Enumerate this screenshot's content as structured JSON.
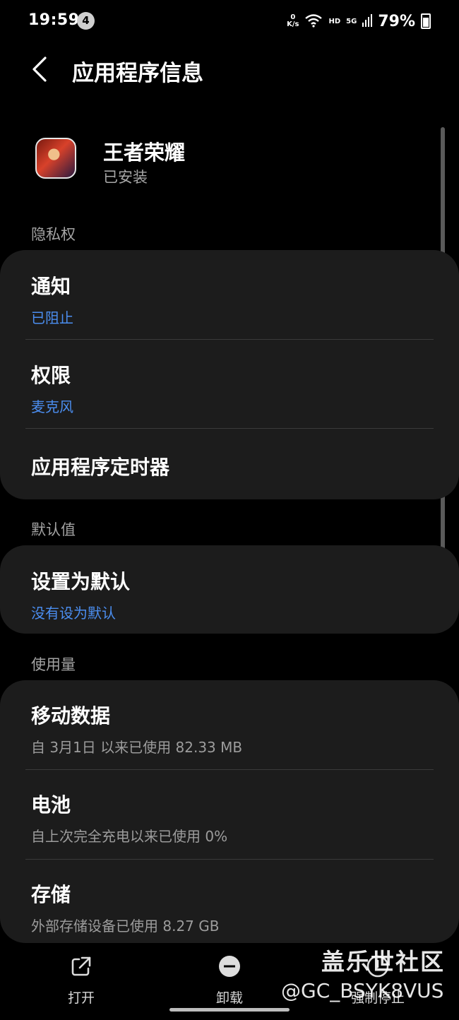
{
  "status_bar": {
    "time": "19:59",
    "notification_count": "4",
    "net_speed_value": "0",
    "net_speed_unit": "K/s",
    "hd_label": "HD",
    "network_label": "5G",
    "battery_percent": "79%"
  },
  "header": {
    "title": "应用程序信息",
    "back_icon": "chevron-left-icon"
  },
  "app": {
    "name": "王者荣耀",
    "status": "已安装"
  },
  "sections": {
    "privacy": "隐私权",
    "defaults": "默认值",
    "usage": "使用量"
  },
  "privacy_items": [
    {
      "title": "通知",
      "subtitle": "已阻止"
    },
    {
      "title": "权限",
      "subtitle": "麦克风"
    },
    {
      "title": "应用程序定时器"
    }
  ],
  "default_items": [
    {
      "title": "设置为默认",
      "subtitle": "没有设为默认"
    }
  ],
  "usage_items": [
    {
      "title": "移动数据",
      "subtitle": "自 3月1日 以来已使用 82.33 MB"
    },
    {
      "title": "电池",
      "subtitle": "自上次完全充电以来已使用 0%"
    },
    {
      "title": "存储",
      "subtitle": "外部存储设备已使用 8.27 GB"
    }
  ],
  "bottom_actions": {
    "open": "打开",
    "uninstall": "卸载",
    "force_stop": "强制停止"
  },
  "watermark": {
    "brand": "盖乐世社区",
    "user": "@GC_BSYK8VUS"
  },
  "colors": {
    "background": "#000000",
    "card": "#1c1c1c",
    "accent_blue": "#4b8ef0",
    "secondary_text": "#9c9c9c"
  }
}
